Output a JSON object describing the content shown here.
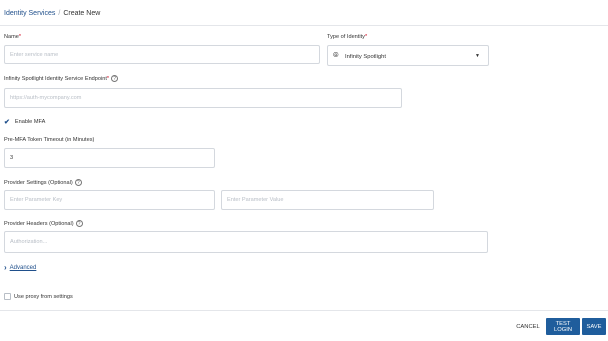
{
  "breadcrumb": {
    "parent": "Identity Services",
    "separator": "/",
    "current": "Create New"
  },
  "name": {
    "label": "Name",
    "required_mark": "*",
    "placeholder": "Enter service name",
    "value": ""
  },
  "type_of_identity": {
    "label": "Type of Identity",
    "required_mark": "*",
    "value": "Infinity Spotlight",
    "icon": "spotlight-icon"
  },
  "endpoint": {
    "label": "Infinity Spotlight Identity Service Endpoint",
    "required_mark": "*",
    "help": "?",
    "placeholder": "https://auth-mycompany.com",
    "value": ""
  },
  "enable_mfa": {
    "label": "Enable MFA",
    "checked": true
  },
  "mfa_timeout": {
    "label": "Pre-MFA Token Timeout (in Minutes)",
    "value": "3"
  },
  "provider_settings": {
    "label": "Provider Settings (Optional)",
    "help": "?",
    "key_placeholder": "Enter Parameter Key",
    "value_placeholder": "Enter Parameter Value"
  },
  "provider_headers": {
    "label": "Provider Headers (Optional)",
    "help": "?",
    "placeholder": "Authorization..."
  },
  "advanced": {
    "label": "Advanced"
  },
  "use_proxy": {
    "label": "Use proxy from settings",
    "checked": false
  },
  "footer": {
    "cancel": "CANCEL",
    "test_login": "TEST LOGIN",
    "save": "SAVE"
  },
  "colors": {
    "accent": "#1f5d9c",
    "link": "#1f4f8b",
    "required": "#d0021b"
  }
}
